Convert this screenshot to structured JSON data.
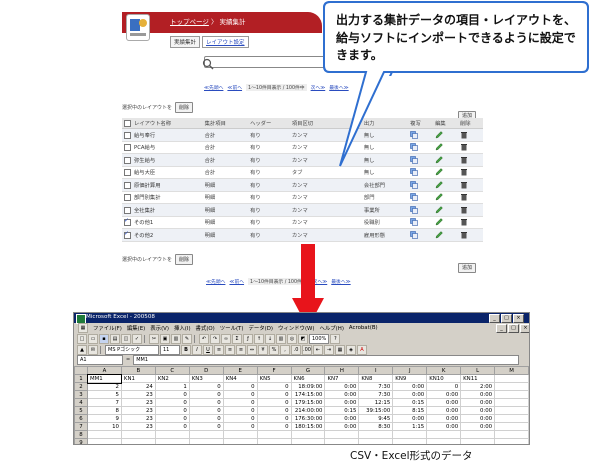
{
  "app": {
    "breadcrumb_home": "トップページ",
    "breadcrumb_sep": "〉",
    "breadcrumb_current": "実績集計",
    "subtabs": [
      "実績集計",
      "レイアウト設定"
    ],
    "pager_top": {
      "prev_prev": "≪先頭へ",
      "prev": "≪前へ",
      "count": "1～10件目表示 / 100件中",
      "next": "次へ≫",
      "last": "最後へ≫"
    },
    "pager_bottom": {
      "prev_prev": "≪先頭へ",
      "prev": "≪前へ",
      "count": "1～10件目表示 / 100件中",
      "next": "次へ≫",
      "last": "最後へ≫"
    },
    "selected_label": "選択中のレイアウトを",
    "delete_label": "削除",
    "add_label": "追加",
    "table": {
      "headers": [
        "レイアウト名称",
        "集計項目",
        "ヘッダー",
        "項目区切",
        "",
        "出力",
        "複写",
        "編集",
        "削除"
      ],
      "rows": [
        {
          "name": "給与奉行",
          "item": "合計",
          "header": "有り",
          "sep": "カンマ",
          "extra": "",
          "output": "無し",
          "checked": false
        },
        {
          "name": "PCA給与",
          "item": "合計",
          "header": "有り",
          "sep": "カンマ",
          "extra": "",
          "output": "無し",
          "checked": false
        },
        {
          "name": "弥生給与",
          "item": "合計",
          "header": "有り",
          "sep": "カンマ",
          "extra": "",
          "output": "無し",
          "checked": false
        },
        {
          "name": "給与大臣",
          "item": "合計",
          "header": "有り",
          "sep": "タブ",
          "extra": "",
          "output": "無し",
          "checked": false
        },
        {
          "name": "原価計算用",
          "item": "明細",
          "header": "有り",
          "sep": "カンマ",
          "extra": "",
          "output": "会社部門",
          "checked": false
        },
        {
          "name": "部門別集計",
          "item": "明細",
          "header": "有り",
          "sep": "カンマ",
          "extra": "",
          "output": "部門",
          "checked": false
        },
        {
          "name": "全社集計",
          "item": "明細",
          "header": "有り",
          "sep": "カンマ",
          "extra": "",
          "output": "事業所",
          "checked": false
        },
        {
          "name": "その他1",
          "item": "明細",
          "header": "有り",
          "sep": "カンマ",
          "extra": "",
          "output": "役職別",
          "checked": true
        },
        {
          "name": "その他2",
          "item": "明細",
          "header": "有り",
          "sep": "カンマ",
          "extra": "",
          "output": "雇用形態",
          "checked": true
        }
      ]
    }
  },
  "callout": {
    "text": "出力する集計データの項目・レイアウトを、給与ソフトにインポートできるように設定できます。"
  },
  "excel": {
    "title": "Microsoft Excel - 200508",
    "menus": [
      "ファイル(F)",
      "編集(E)",
      "表示(V)",
      "挿入(I)",
      "書式(O)",
      "ツール(T)",
      "データ(D)",
      "ウィンドウ(W)",
      "ヘルプ(H)",
      "Acrobat(B)"
    ],
    "zoom": "100%",
    "font_name": "MS Pゴシック",
    "font_size": "11",
    "namebox": "A1",
    "formula_value": "MM1",
    "columns": [
      "A",
      "B",
      "C",
      "D",
      "E",
      "F",
      "G",
      "H",
      "I",
      "J",
      "K",
      "L",
      "M"
    ],
    "rows": [
      [
        "MM1",
        "KN1",
        "KN2",
        "KN3",
        "KN4",
        "KN5",
        "KN6",
        "KN7",
        "KN8",
        "KN9",
        "KN10",
        "KN11",
        ""
      ],
      [
        "2",
        "24",
        "1",
        "0",
        "0",
        "0",
        "18:09:00",
        "0:00",
        "7:30",
        "0:00",
        "0",
        "2:00",
        ""
      ],
      [
        "5",
        "23",
        "0",
        "0",
        "0",
        "0",
        "174:15:00",
        "0:00",
        "7:30",
        "0:00",
        "0:00",
        "0:00",
        ""
      ],
      [
        "7",
        "23",
        "0",
        "0",
        "0",
        "0",
        "179:15:00",
        "0:00",
        "12:15",
        "0:15",
        "0:00",
        "0:00",
        ""
      ],
      [
        "8",
        "23",
        "0",
        "0",
        "0",
        "0",
        "214:00:00",
        "0:15",
        "39:15:00",
        "8:15",
        "0:00",
        "0:00",
        ""
      ],
      [
        "9",
        "23",
        "0",
        "0",
        "0",
        "0",
        "176:30:00",
        "0:00",
        "9:45",
        "0:00",
        "0:00",
        "0:00",
        ""
      ],
      [
        "10",
        "23",
        "0",
        "0",
        "0",
        "0",
        "180:15:00",
        "0:00",
        "8:30",
        "1:15",
        "0:00",
        "0:00",
        ""
      ]
    ]
  },
  "caption": "CSV・Excel形式のデータ",
  "colors": {
    "brand_red": "#b21f24",
    "callout_border": "#2f6fd0",
    "arrow_red": "#e8141b",
    "excel_title": "#0a246a"
  }
}
